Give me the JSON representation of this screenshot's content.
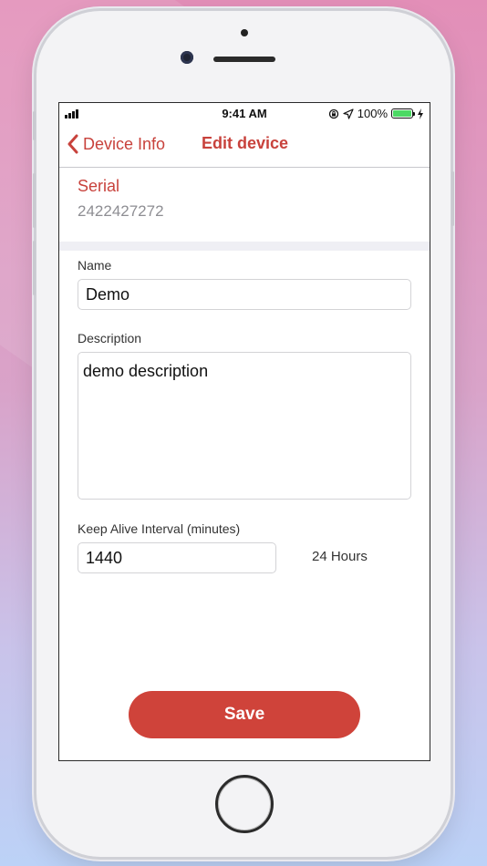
{
  "status_bar": {
    "time": "9:41 AM",
    "battery": "100%",
    "icons": [
      "signal-icon",
      "lock-rotation-icon",
      "location-icon",
      "battery-icon",
      "charging-icon"
    ]
  },
  "nav": {
    "back_label": "Device Info",
    "title": "Edit device"
  },
  "serial": {
    "label": "Serial",
    "value": "2422427272"
  },
  "form": {
    "name_label": "Name",
    "name_value": "Demo",
    "description_label": "Description",
    "description_value": "demo description",
    "keepalive_label": "Keep Alive Interval (minutes)",
    "keepalive_value": "1440",
    "keepalive_hint": "24 Hours"
  },
  "actions": {
    "save_label": "Save"
  },
  "colors": {
    "accent": "#c8423c",
    "save_button": "#cf433a",
    "battery_fill": "#4cd964"
  }
}
